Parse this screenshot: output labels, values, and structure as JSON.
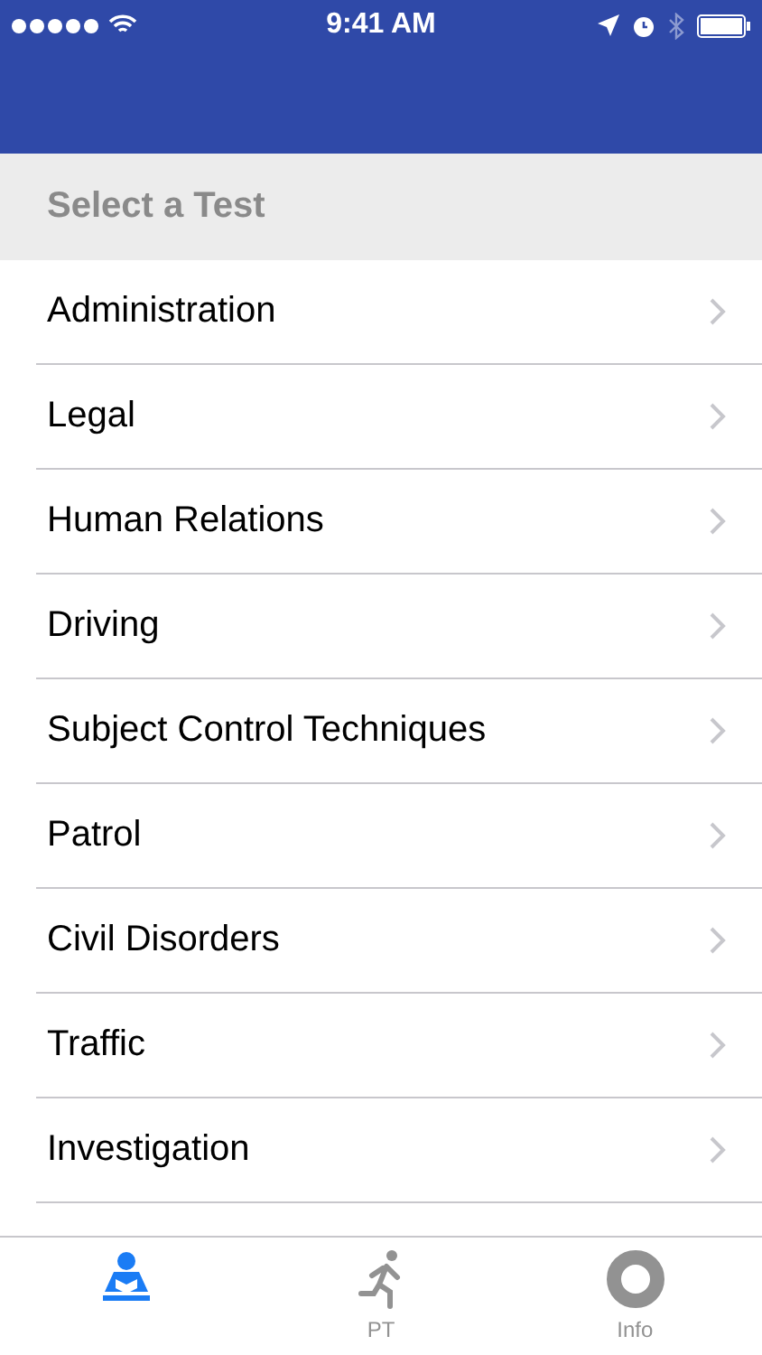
{
  "status_bar": {
    "time": "9:41 AM",
    "bluetooth_on": false
  },
  "section_header": "Select a Test",
  "tests": [
    {
      "label": "Administration"
    },
    {
      "label": "Legal"
    },
    {
      "label": "Human Relations"
    },
    {
      "label": "Driving"
    },
    {
      "label": "Subject Control Techniques"
    },
    {
      "label": "Patrol"
    },
    {
      "label": "Civil Disorders"
    },
    {
      "label": "Traffic"
    },
    {
      "label": "Investigation"
    }
  ],
  "tab_bar": [
    {
      "kind": "reader",
      "selected": true
    },
    {
      "kind": "runner",
      "label": "PT",
      "selected": false
    },
    {
      "kind": "lifebuoy",
      "label": "Info",
      "selected": false
    }
  ]
}
